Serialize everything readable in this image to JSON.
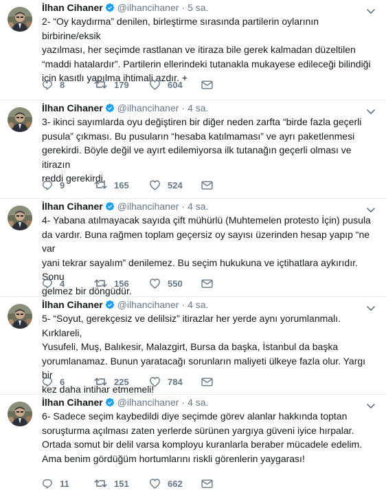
{
  "colors": {
    "name": "#14171a",
    "meta": "#657786",
    "verified": "#1da1f2",
    "divider": "#e6ecf0"
  },
  "icons": [
    "avatar",
    "verified-badge-icon",
    "chevron-down-icon",
    "reply-icon",
    "retweet-icon",
    "like-icon",
    "direct-message-icon"
  ],
  "tweets": [
    {
      "fullname": "İlhan Cihaner",
      "username": "@ilhancihaner",
      "separator": "·",
      "time": "5 sa.",
      "text": "2- “Oy kaydırma” denilen, birleştirme sırasında partilerin oylarının birbirine/eksik\nyazılması, her seçimde rastlanan ve itiraza bile gerek kalmadan düzeltilen\n“maddi hatalardır”. Partilerin ellerindeki tutanakla mukayese edileceği bilindiği\niçin kasıtlı yapılma ihtimali azdır. +",
      "replies": "8",
      "retweets": "179",
      "likes": "604"
    },
    {
      "fullname": "İlhan Cihaner",
      "username": "@ilhancihaner",
      "separator": "·",
      "time": "4 sa.",
      "text": "3- ikinci sayımlarda oyu değiştiren bir diğer neden zarfta “birde fazla geçerli\npusula” çıkması. Bu pusuların “hesaba katılmaması” ve ayrı paketlenmesi\ngerekirdi. Böyle değil ve ayırt edilemiyorsa ilk tutanağın geçerli olması ve itirazın\nreddi gerekirdi.",
      "replies": "9",
      "retweets": "165",
      "likes": "524"
    },
    {
      "fullname": "İlhan Cihaner",
      "username": "@ilhancihaner",
      "separator": "·",
      "time": "4 sa.",
      "text": "4- Yabana atılmayacak sayıda çift mühürlü (Muhtemelen protesto İçin) pusula\nda vardır. Buna rağmen toplam geçersiz oy sayısı üzerinden hesap yapıp “ne var\nyani tekrar sayalım” denilemez. Bu seçim hukukuna ve içtihatlara aykırıdır. Sonu\ngelmez bir döngüdür.",
      "replies": "4",
      "retweets": "156",
      "likes": "550"
    },
    {
      "fullname": "İlhan Cihaner",
      "username": "@ilhancihaner",
      "separator": "·",
      "time": "4 sa.",
      "text": "5- “Soyut, gerekçesiz ve delilsiz” itirazlar her yerde aynı yorumlanmalı. Kırklareli,\nYusufeli, Muş, Balıkesir, Malazgirt, Bursa da başka, İstanbul da  başka\nyorumlanamaz. Bunun yaratacağı sorunların maliyeti ülkeye fazla olur. Yargı bir\nkez daha intihar etmemeli!",
      "replies": "6",
      "retweets": "225",
      "likes": "784"
    },
    {
      "fullname": "İlhan Cihaner",
      "username": "@ilhancihaner",
      "separator": "·",
      "time": "4 sa.",
      "text": "6- Sadece seçim kaybedildi diye seçimde görev alanlar hakkında toptan\nsoruşturma açılması zaten yerlerde sürünen yargıya güveni iyice hırpalar.\nOrtada somut bir delil varsa komployu kuranlarla beraber mücadele edelim.\nAma benim gördüğüm hortumlarını riskli görenlerin yaygarası!",
      "replies": "11",
      "retweets": "151",
      "likes": "662"
    }
  ]
}
